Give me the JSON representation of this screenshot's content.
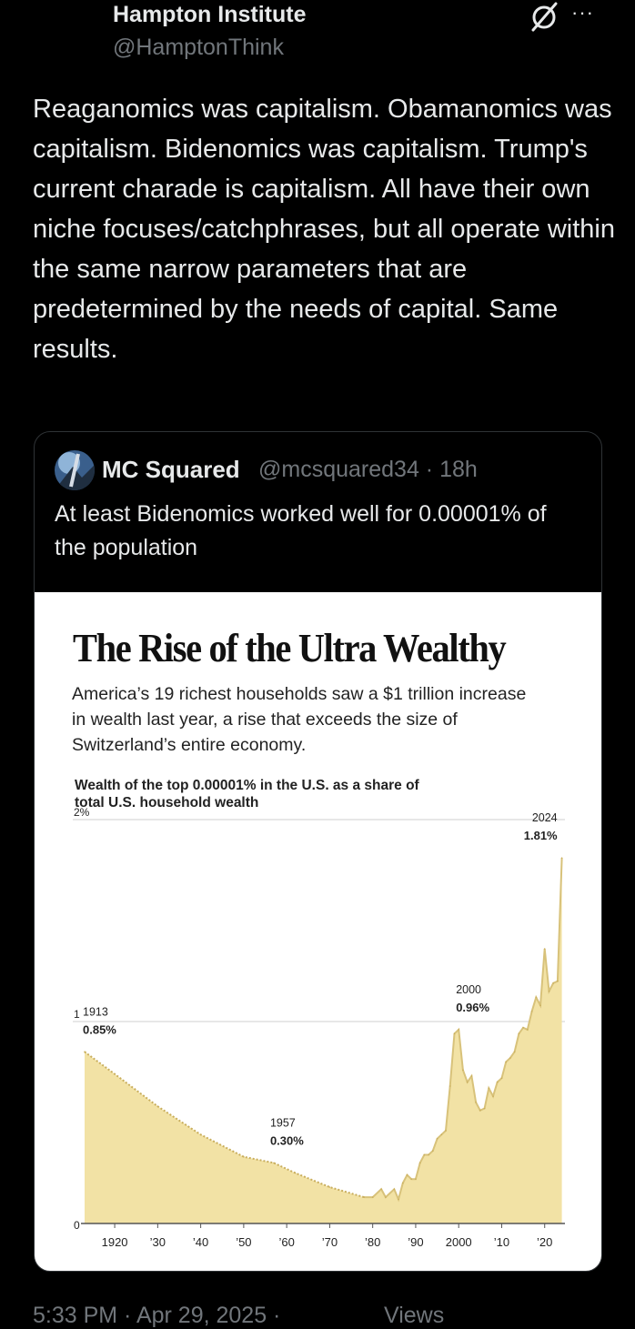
{
  "post": {
    "display_name": "Hampton Institute",
    "handle": "@HamptonThink",
    "text": "Reaganomics was capitalism. Obamanomics was capitalism. Bidenomics was capitalism. Trump's current charade is capitalism. All have their own niche focuses/catchphrases, but all operate within the same narrow parameters that are predetermined by the needs of capital. Same results.",
    "icons": [
      "grok-icon",
      "more-icon"
    ],
    "more_glyph": "···",
    "timestamp": "5:33 PM · Apr 29, 2025 ·",
    "views_label": "Views"
  },
  "quote": {
    "display_name": "MC Squared",
    "meta": "@mcsquared34 · 18h",
    "text": "At least Bidenomics worked well for 0.00001% of the population"
  },
  "chart_data": {
    "type": "area",
    "title": "The Rise of the Ultra Wealthy",
    "subtitle": "America’s 19 richest households saw a $1 trillion increase in wealth last year, a rise that exceeds the size of Switzerland’s entire economy.",
    "ylabel": "Wealth of the top 0.00001% in the U.S. as a share of total U.S. household wealth",
    "ylim": [
      0,
      2
    ],
    "xlim": [
      1913,
      2024
    ],
    "y_ticks": [
      {
        "value": 0,
        "label": "0"
      },
      {
        "value": 1,
        "label": "1"
      },
      {
        "value": 2,
        "label": "2%"
      }
    ],
    "x_ticks": [
      {
        "value": 1920,
        "label": "1920"
      },
      {
        "value": 1930,
        "label": "’30"
      },
      {
        "value": 1940,
        "label": "’40"
      },
      {
        "value": 1950,
        "label": "’50"
      },
      {
        "value": 1960,
        "label": "’60"
      },
      {
        "value": 1970,
        "label": "’70"
      },
      {
        "value": 1980,
        "label": "’80"
      },
      {
        "value": 1990,
        "label": "’90"
      },
      {
        "value": 2000,
        "label": "2000"
      },
      {
        "value": 2010,
        "label": "’10"
      },
      {
        "value": 2020,
        "label": "’20"
      }
    ],
    "annotations": [
      {
        "x": 1913,
        "y": 0.85,
        "year": "1913",
        "value": "0.85%"
      },
      {
        "x": 1957,
        "y": 0.3,
        "year": "1957",
        "value": "0.30%"
      },
      {
        "x": 2000,
        "y": 0.96,
        "year": "2000",
        "value": "0.96%"
      },
      {
        "x": 2024,
        "y": 1.81,
        "year": "2024",
        "value": "1.81%"
      }
    ],
    "series": [
      {
        "x": [
          1913,
          1920,
          1930,
          1940,
          1950,
          1957,
          1962,
          1970,
          1978,
          1980,
          1982,
          1983,
          1985,
          1986,
          1987,
          1988,
          1989,
          1990,
          1991,
          1992,
          1993,
          1994,
          1995,
          1996,
          1997,
          1998,
          1999,
          2000,
          2001,
          2002,
          2003,
          2004,
          2005,
          2006,
          2007,
          2008,
          2009,
          2010,
          2011,
          2012,
          2013,
          2014,
          2015,
          2016,
          2017,
          2018,
          2019,
          2020,
          2021,
          2022,
          2023,
          2024
        ],
        "y": [
          0.85,
          0.74,
          0.58,
          0.44,
          0.33,
          0.3,
          0.25,
          0.18,
          0.13,
          0.13,
          0.17,
          0.13,
          0.17,
          0.12,
          0.2,
          0.24,
          0.22,
          0.22,
          0.3,
          0.34,
          0.34,
          0.36,
          0.42,
          0.44,
          0.46,
          0.68,
          0.94,
          0.96,
          0.76,
          0.7,
          0.73,
          0.6,
          0.56,
          0.57,
          0.67,
          0.63,
          0.7,
          0.72,
          0.8,
          0.82,
          0.85,
          0.94,
          0.97,
          0.96,
          1.05,
          1.12,
          1.08,
          1.36,
          1.15,
          1.19,
          1.2,
          1.81
        ]
      }
    ],
    "area_color": "#f2e2a5",
    "line_color": "#d8c27a",
    "grid": true
  }
}
